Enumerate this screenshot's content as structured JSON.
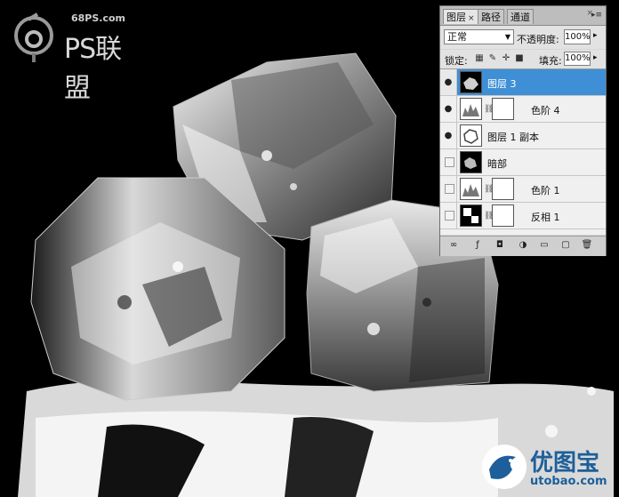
{
  "watermarks": {
    "top_site": "68PS.com",
    "top_brand": "PS联盟",
    "bottom_cn": "优图宝",
    "bottom_url": "utobao.com"
  },
  "panel": {
    "tabs": [
      {
        "label": "图层",
        "active": true,
        "close": "×"
      },
      {
        "label": "路径",
        "active": false
      },
      {
        "label": "通道",
        "active": false
      }
    ],
    "close_glyph": "×",
    "menu_glyph": "▸≡",
    "blend_mode": "正常",
    "opacity_label": "不透明度:",
    "opacity_value": "100%",
    "lock_label": "锁定:",
    "fill_label": "填充:",
    "fill_value": "100%",
    "layers": [
      {
        "name": "图层 3",
        "visible": true,
        "selected": true,
        "kind": "pixel"
      },
      {
        "name": "色阶 4",
        "visible": true,
        "selected": false,
        "kind": "adjustment-levels"
      },
      {
        "name": "图层 1 副本",
        "visible": true,
        "selected": false,
        "kind": "pixel"
      },
      {
        "name": "暗部",
        "visible": false,
        "selected": false,
        "kind": "pixel"
      },
      {
        "name": "色阶 1",
        "visible": false,
        "selected": false,
        "kind": "adjustment-levels"
      },
      {
        "name": "反相 1",
        "visible": false,
        "selected": false,
        "kind": "adjustment-invert"
      }
    ],
    "footer_icons": [
      "link-icon",
      "fx-icon",
      "mask-icon",
      "adjustment-icon",
      "group-icon",
      "new-layer-icon",
      "trash-icon"
    ]
  },
  "colors": {
    "selected_row": "#3f8fd6",
    "panel_bg": "#d6d6d6",
    "watermark_blue": "#1d5f9a"
  }
}
